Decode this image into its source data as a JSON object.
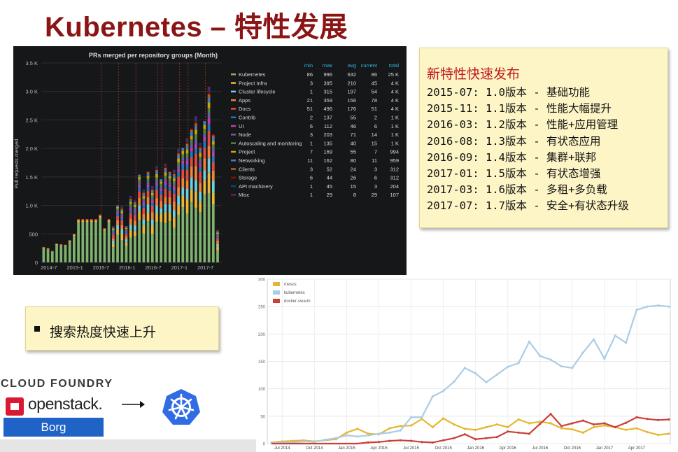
{
  "slide": {
    "title": "Kubernetes – 特性发展"
  },
  "note": {
    "title": "新特性快速发布",
    "releases": [
      "2015-07: 1.0版本 - 基础功能",
      "2015-11: 1.1版本 - 性能大幅提升",
      "2016-03: 1.2版本 - 性能+应用管理",
      "2016-08: 1.3版本 - 有状态应用",
      "2016-09: 1.4版本 - 集群+联邦",
      "2017-01: 1.5版本 - 有状态增强",
      "2017-03: 1.6版本 - 多租+多负载",
      "2017-07: 1.7版本 - 安全+有状态升级"
    ]
  },
  "search_box": {
    "text": "搜索热度快速上升"
  },
  "logos": {
    "cloudfoundry": "CLOUD FOUNDRY",
    "openstack": "openstack.",
    "borg": "Borg",
    "kubernetes_icon": "kubernetes-wheel-icon",
    "arrow_icon": "right-arrow-icon"
  },
  "colors": {
    "title": "#8b1414",
    "note_title": "#c0161b",
    "note_bg": "#fdf5c6",
    "grafana_bg": "#161719",
    "borg_bg": "#1f63c6",
    "k8s_blue": "#326ce5"
  },
  "chart_data": [
    {
      "type": "bar",
      "stacked": true,
      "title": "PRs merged per repository groups (Month)",
      "ylabel": "Pull requests merged",
      "ylim": [
        0,
        3500
      ],
      "yticks": [
        "0",
        "500",
        "1.0 K",
        "1.5 K",
        "2.0 K",
        "2.5 K",
        "3.0 K",
        "3.5 K"
      ],
      "xticks": [
        "2014-7",
        "2015-1",
        "2015-7",
        "2016-1",
        "2016-7",
        "2017-1",
        "2017-7"
      ],
      "release_markers": [
        "2015-07",
        "2015-11",
        "2016-03",
        "2016-08",
        "2016-09",
        "2017-01",
        "2017-03",
        "2017-07"
      ],
      "months": [
        "2014-06",
        "2014-07",
        "2014-08",
        "2014-09",
        "2014-10",
        "2014-11",
        "2014-12",
        "2015-01",
        "2015-02",
        "2015-03",
        "2015-04",
        "2015-05",
        "2015-06",
        "2015-07",
        "2015-08",
        "2015-09",
        "2015-10",
        "2015-11",
        "2015-12",
        "2016-01",
        "2016-02",
        "2016-03",
        "2016-04",
        "2016-05",
        "2016-06",
        "2016-07",
        "2016-08",
        "2016-09",
        "2016-10",
        "2016-11",
        "2016-12",
        "2017-01",
        "2017-02",
        "2017-03",
        "2017-04",
        "2017-05",
        "2017-06",
        "2017-07",
        "2017-08",
        "2017-09",
        "2017-10"
      ],
      "totals": [
        270,
        250,
        200,
        330,
        320,
        310,
        390,
        500,
        760,
        760,
        760,
        760,
        760,
        840,
        600,
        760,
        640,
        1000,
        1000,
        640,
        1220,
        1100,
        1540,
        1300,
        1600,
        1400,
        1690,
        1460,
        1760,
        1600,
        1700,
        1990,
        2010,
        2210,
        2350,
        2680,
        2100,
        2480,
        3130,
        2250,
        600
      ],
      "table_headers": [
        "min",
        "max",
        "avg",
        "current",
        "total"
      ],
      "series": [
        {
          "name": "Kubernetes",
          "color": "#7eb26d",
          "min": "86",
          "max": "996",
          "avg": "632",
          "current": "86",
          "total": "25 K"
        },
        {
          "name": "Project Infra",
          "color": "#eab839",
          "min": "3",
          "max": "395",
          "avg": "210",
          "current": "45",
          "total": "4 K"
        },
        {
          "name": "Cluster lifecycle",
          "color": "#6ed0e0",
          "min": "1",
          "max": "315",
          "avg": "197",
          "current": "54",
          "total": "4 K"
        },
        {
          "name": "Apps",
          "color": "#ef843c",
          "min": "21",
          "max": "359",
          "avg": "156",
          "current": "78",
          "total": "4 K"
        },
        {
          "name": "Docs",
          "color": "#e24d42",
          "min": "51",
          "max": "496",
          "avg": "176",
          "current": "51",
          "total": "4 K"
        },
        {
          "name": "Contrib",
          "color": "#1f78c1",
          "min": "2",
          "max": "137",
          "avg": "55",
          "current": "2",
          "total": "1 K"
        },
        {
          "name": "UI",
          "color": "#ba43a9",
          "min": "6",
          "max": "112",
          "avg": "46",
          "current": "6",
          "total": "1 K"
        },
        {
          "name": "Node",
          "color": "#705da0",
          "min": "3",
          "max": "203",
          "avg": "71",
          "current": "14",
          "total": "1 K"
        },
        {
          "name": "Autoscaling and monitoring",
          "color": "#508642",
          "min": "1",
          "max": "135",
          "avg": "40",
          "current": "15",
          "total": "1 K"
        },
        {
          "name": "Project",
          "color": "#cca300",
          "min": "7",
          "max": "169",
          "avg": "55",
          "current": "7",
          "total": "994"
        },
        {
          "name": "Networking",
          "color": "#447ebc",
          "min": "11",
          "max": "162",
          "avg": "80",
          "current": "11",
          "total": "959"
        },
        {
          "name": "Clients",
          "color": "#c15c17",
          "min": "3",
          "max": "52",
          "avg": "24",
          "current": "3",
          "total": "312"
        },
        {
          "name": "Storage",
          "color": "#890f02",
          "min": "6",
          "max": "44",
          "avg": "26",
          "current": "6",
          "total": "312"
        },
        {
          "name": "API machinery",
          "color": "#0a437c",
          "min": "1",
          "max": "45",
          "avg": "15",
          "current": "3",
          "total": "204"
        },
        {
          "name": "Misc",
          "color": "#6d1f62",
          "min": "1",
          "max": "29",
          "avg": "8",
          "current": "29",
          "total": "107"
        }
      ]
    },
    {
      "type": "line",
      "ylim": [
        0,
        300
      ],
      "yticks": [
        "0",
        "50",
        "100",
        "150",
        "200",
        "250",
        "300"
      ],
      "xticks": [
        "Jul 2014",
        "Oct 2014",
        "Jan 2015",
        "Apr 2015",
        "Jul 2015",
        "Oct 2015",
        "Jan 2016",
        "Apr 2016",
        "Jul 2016",
        "Oct 2016",
        "Jan 2017",
        "Apr 2017"
      ],
      "x": [
        0,
        1,
        2,
        3,
        4,
        5,
        6,
        7,
        8,
        9,
        10,
        11,
        12,
        13,
        14,
        15,
        16,
        17,
        18,
        19,
        20,
        21,
        22,
        23,
        24,
        25,
        26,
        27,
        28,
        29,
        30,
        31,
        32,
        33,
        34,
        35,
        36,
        37
      ],
      "series": [
        {
          "name": "mesos",
          "color": "#e6b731",
          "values": [
            2,
            4,
            5,
            6,
            4,
            6,
            8,
            20,
            27,
            18,
            17,
            28,
            32,
            33,
            45,
            30,
            46,
            35,
            27,
            25,
            30,
            35,
            30,
            44,
            37,
            40,
            37,
            28,
            26,
            20,
            30,
            33,
            30,
            25,
            28,
            21,
            16,
            18
          ]
        },
        {
          "name": "kubernetes",
          "color": "#aacde6",
          "values": [
            1,
            2,
            2,
            4,
            3,
            7,
            10,
            15,
            13,
            15,
            18,
            20,
            24,
            48,
            48,
            86,
            96,
            113,
            138,
            128,
            112,
            126,
            140,
            147,
            186,
            160,
            153,
            141,
            138,
            166,
            190,
            155,
            197,
            184,
            244,
            250,
            252,
            250
          ]
        },
        {
          "name": "docker-swarm",
          "color": "#c9403a",
          "values": [
            0,
            0,
            0,
            0,
            0,
            0,
            0,
            0,
            0,
            2,
            3,
            5,
            6,
            5,
            3,
            2,
            6,
            10,
            17,
            8,
            10,
            12,
            22,
            20,
            18,
            36,
            54,
            32,
            37,
            42,
            35,
            37,
            30,
            38,
            48,
            45,
            43,
            44
          ]
        }
      ]
    }
  ]
}
